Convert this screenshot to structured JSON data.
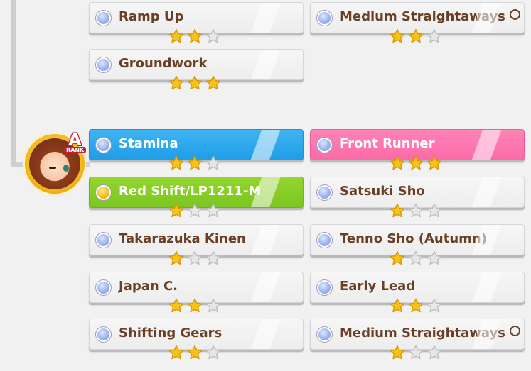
{
  "avatar": {
    "rank_letter": "A",
    "rank_word": "RANK"
  },
  "top_skills": [
    {
      "label": "Ramp Up",
      "stars": 2,
      "marker": "",
      "color": "default",
      "dot": "blue"
    },
    {
      "label": "Medium Straightaways",
      "stars": 2,
      "marker": "○",
      "color": "default",
      "dot": "blue"
    },
    {
      "label": "Groundwork",
      "stars": 3,
      "marker": "",
      "color": "default",
      "dot": "blue"
    }
  ],
  "skills": [
    {
      "label": "Stamina",
      "stars": 2,
      "marker": "",
      "color": "#2aa8ee",
      "dot": "blue"
    },
    {
      "label": "Front Runner",
      "stars": 3,
      "marker": "",
      "color": "#fb6aa8",
      "dot": "blue"
    },
    {
      "label": "Red Shift/LP1211-M",
      "stars": 1,
      "marker": "",
      "color": "#86cc24",
      "dot": "gold"
    },
    {
      "label": "Satsuki Sho",
      "stars": 1,
      "marker": "",
      "color": "default",
      "dot": "blue"
    },
    {
      "label": "Takarazuka Kinen",
      "stars": 1,
      "marker": "",
      "color": "default",
      "dot": "blue"
    },
    {
      "label": "Tenno Sho (Autumn)",
      "stars": 1,
      "marker": "",
      "color": "default",
      "dot": "blue"
    },
    {
      "label": "Japan C.",
      "stars": 2,
      "marker": "",
      "color": "default",
      "dot": "blue"
    },
    {
      "label": "Early Lead",
      "stars": 2,
      "marker": "",
      "color": "default",
      "dot": "blue"
    },
    {
      "label": "Shifting Gears",
      "stars": 2,
      "marker": "",
      "color": "default",
      "dot": "blue"
    },
    {
      "label": "Medium Straightaways",
      "stars": 1,
      "marker": "○",
      "color": "default",
      "dot": "blue"
    }
  ],
  "star_max": 3,
  "colors": {
    "star_filled": "#f7c21a",
    "star_empty": "#e6e6e6",
    "label_text": "#6b3f26"
  }
}
